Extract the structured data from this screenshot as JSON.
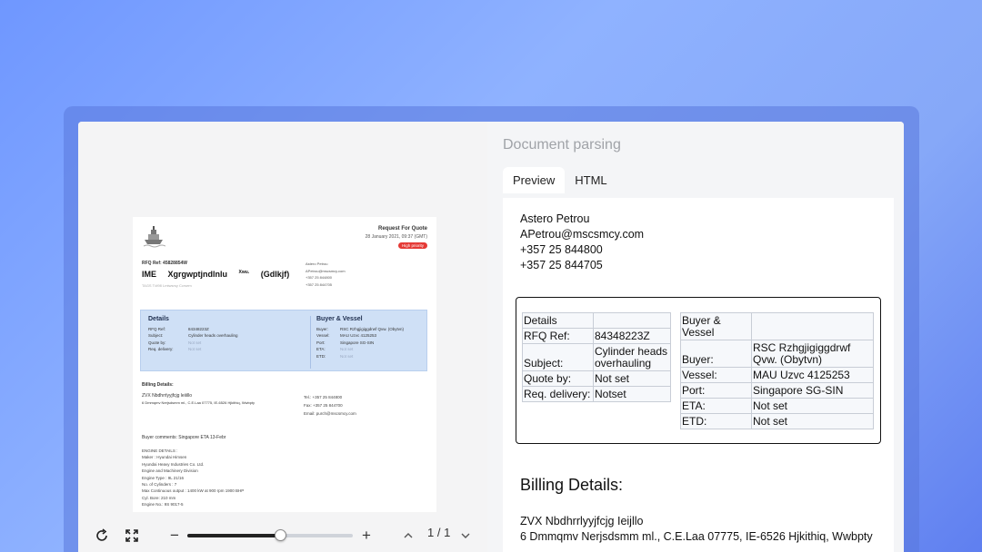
{
  "left_document": {
    "rfq_title": "Request For Quote",
    "date": "28 January 2021, 09:37 (GMT)",
    "badge": "High priority",
    "rfq_ref": "RFQ Ref: 45828854W",
    "big_line": [
      "IME",
      "Xgrgwptjndlnlu",
      "Xwu.",
      "(Gdlkjf)"
    ],
    "tags": "TAGS  T/#98   Lmtwsrsy Ccrsem",
    "contact": [
      "Astero Petrou",
      "APetrou@mscsmcy.com",
      "+357 25 844800",
      "+357 25 844705"
    ],
    "details_title": "Details",
    "details": [
      {
        "k": "RFQ Ref:",
        "v": "84348223Z"
      },
      {
        "k": "Subject:",
        "v": "Cylinder heads overhauling"
      },
      {
        "k": "Quote by:",
        "v": "Not set"
      },
      {
        "k": "Req. delivery:",
        "v": "Not set"
      }
    ],
    "buyer_title": "Buyer & Vessel",
    "buyer": [
      {
        "k": "Buyer:",
        "v": "RSC Rzhgjigiggdrwf Qvw. (Obytvn)"
      },
      {
        "k": "Vessel:",
        "v": "MAU Uzvc 4125253"
      },
      {
        "k": "Port:",
        "v": "Singapore SG-SIN"
      },
      {
        "k": "ETA:",
        "v": "Not set"
      },
      {
        "k": "ETD:",
        "v": "Not set"
      }
    ],
    "billing_label": "Billing Details:",
    "billing_lines": [
      "ZVX  Nbdhrrlyyjfcjg   leiiillo",
      "6 Dmmqmv Nerjsdsmm ml., C.E.Laa 07775, IE-6526 Hjkithiq, Wwbpty"
    ],
    "billing_right": [
      "Tel.: +357 25 844800",
      "Fax: +357 25 844700",
      "Email: purch@mscsmcy.com"
    ],
    "buyer_comments": "Buyer comments:  Singapore ETA 13-Febr",
    "engine_lines": [
      "ENGINE DETAILS :",
      "Maker : Hyundai Himsen",
      "Hyundai Heavy Industries Co. Ltd.",
      "Engine and Machinery Division",
      "Engine Type : 9L 21/16",
      "No. of Cylinders : 7",
      "Max Continuous output : 1400 kW at 900 rpm 1900 BHP",
      "Cyl. Bore: 210 mm",
      "Engine No.: 9S 9017-5"
    ]
  },
  "viewer_controls": {
    "zoom_level": 0.56,
    "page_indicator": "1 / 1"
  },
  "right_pane": {
    "title": "Document parsing",
    "tabs": [
      "Preview",
      "HTML"
    ],
    "contact": [
      "Astero Petrou",
      "APetrou@mscsmcy.com",
      "+357 25 844800",
      "+357 25 844705"
    ],
    "details_table": [
      [
        "Details",
        ""
      ],
      [
        "RFQ Ref:",
        "84348223Z"
      ],
      [
        "Subject:",
        "Cylinder heads overhauling"
      ],
      [
        "Quote by:",
        "Not set"
      ],
      [
        "Req. delivery:",
        "Notset"
      ]
    ],
    "buyer_table": [
      [
        "Buyer & Vessel",
        ""
      ],
      [
        "Buyer:",
        "RSC Rzhgjigiggdrwf Qvw. (Obytvn)"
      ],
      [
        "Vessel:",
        "MAU Uzvc 4125253"
      ],
      [
        "Port:",
        "Singapore SG-SIN"
      ],
      [
        "ETA:",
        "Not set"
      ],
      [
        "ETD:",
        "Not set"
      ]
    ],
    "billing_heading": "Billing Details:",
    "billing_lines": [
      "ZVX Nbdhrrlyyjfcjg Ieijllo",
      "6 Dmmqmv Nerjsdsmm ml., C.E.Laa 07775, IE-6526 Hjkithiq, Wwbpty"
    ]
  }
}
